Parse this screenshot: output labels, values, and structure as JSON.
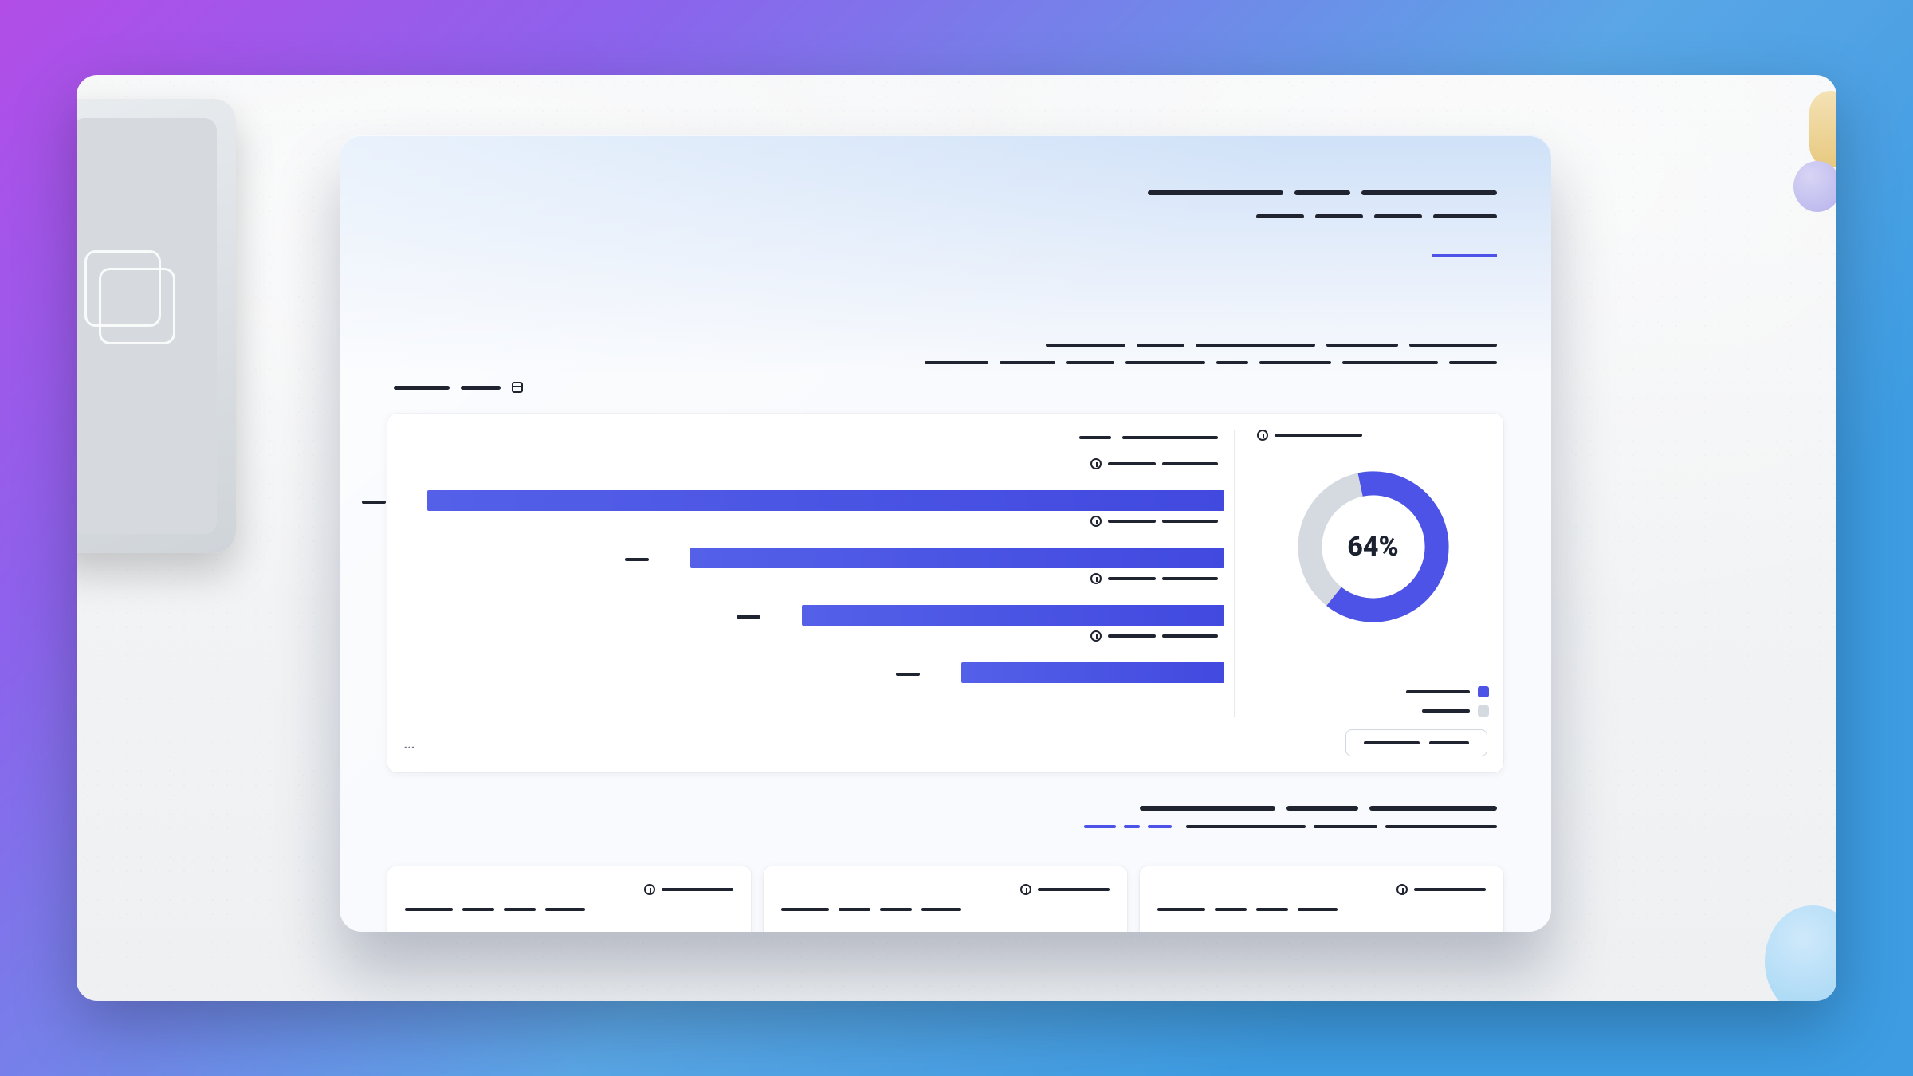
{
  "colors": {
    "accent": "#4c53e6",
    "grey": "#d5dae1",
    "ink": "#1f2430"
  },
  "header": {
    "title_segments": [
      170,
      70,
      170
    ],
    "nav_segments": [
      60,
      60,
      60,
      80
    ],
    "nav_active_index": 3
  },
  "subheader": {
    "line1_segments": [
      100,
      60,
      150,
      90,
      110
    ],
    "line2_segments": [
      80,
      70,
      60,
      100,
      40,
      90,
      120,
      60
    ]
  },
  "section": {
    "title_segments": [
      70,
      50
    ],
    "has_calendar_icon": true
  },
  "card": {
    "chart_title_segments": [
      40,
      120
    ],
    "footer_ellipsis": "…",
    "action_segments": [
      70,
      50
    ]
  },
  "side": {
    "title_segments": [
      110
    ],
    "legend": [
      {
        "color": "#4c53e6",
        "segments": [
          80
        ]
      },
      {
        "color": "#d5dae1",
        "segments": [
          60
        ]
      }
    ]
  },
  "chart_data": {
    "type": "bar",
    "orientation": "horizontal",
    "series": [
      {
        "name": "",
        "values": [
          100,
          67,
          53,
          33
        ]
      }
    ],
    "categories": [
      "",
      "",
      "",
      ""
    ],
    "donut": {
      "percent": 64,
      "remaining": 36,
      "center_label": "64%"
    }
  },
  "section2": {
    "title_segments": [
      170,
      90,
      160
    ],
    "tabs": [
      {
        "active": true,
        "segments": [
          40,
          20,
          30
        ]
      },
      {
        "active": false,
        "segments": [
          150,
          80,
          140
        ]
      }
    ]
  },
  "mini_cards": [
    {
      "title_segments": [
        90
      ],
      "sub_segments": [
        60,
        40,
        40,
        50
      ],
      "value_segments": [
        40
      ],
      "bar": 36
    },
    {
      "title_segments": [
        90
      ],
      "sub_segments": [
        60,
        40,
        40,
        50
      ],
      "value_segments": [
        40
      ],
      "bar": 34
    },
    {
      "title_segments": [
        90
      ],
      "sub_segments": [
        60,
        40,
        40,
        50
      ],
      "value_segments": [
        40
      ],
      "bar": 40
    }
  ]
}
